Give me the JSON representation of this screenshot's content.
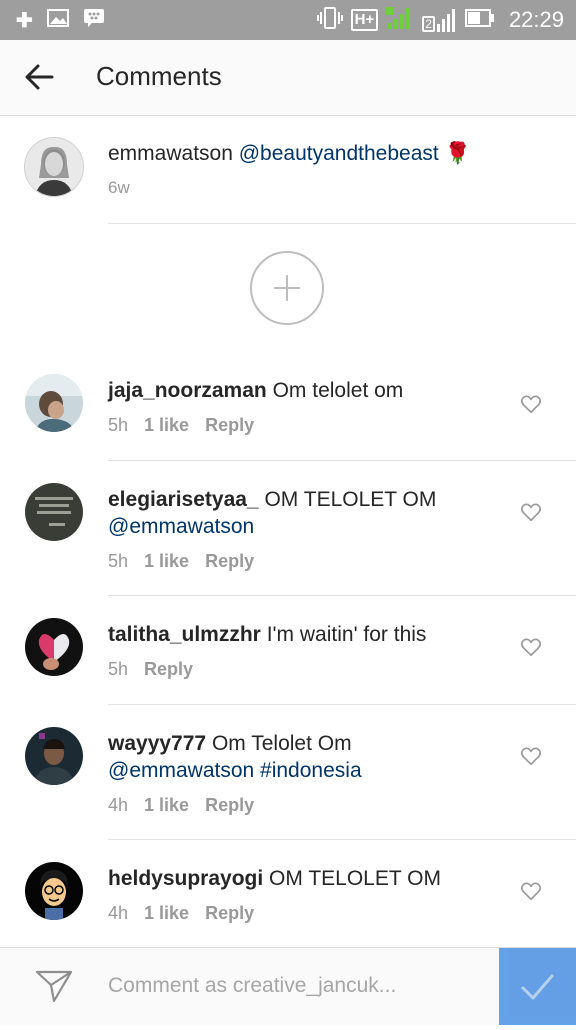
{
  "status_bar": {
    "time": "22:29",
    "network_type": "H+",
    "sim2_label": "2",
    "icons": [
      "kakao-icon",
      "image-icon",
      "bbm-icon",
      "vibrate-icon",
      "network-icon",
      "signal-icon",
      "battery-icon"
    ]
  },
  "header": {
    "title": "Comments",
    "back_icon": "arrow-left-icon"
  },
  "caption": {
    "username": "emmawatson",
    "text": "@beautyandthebeast",
    "emoji": "🌹",
    "time": "6w"
  },
  "load_more_icon": "plus-circle-icon",
  "comments": [
    {
      "username": "jaja_noorzaman",
      "text": "Om telolet om",
      "mention": "",
      "time": "5h",
      "likes": "1 like",
      "reply": "Reply"
    },
    {
      "username": "elegiarisetyaa_",
      "text": "OM TELOLET OM",
      "mention": "@emmawatson",
      "time": "5h",
      "likes": "1 like",
      "reply": "Reply"
    },
    {
      "username": "talitha_ulmzzhr",
      "text": "I'm waitin' for this",
      "mention": "",
      "time": "5h",
      "likes": "",
      "reply": "Reply"
    },
    {
      "username": "wayyy777",
      "text": "Om Telolet Om",
      "mention": "@emmawatson #indonesia",
      "time": "4h",
      "likes": "1 like",
      "reply": "Reply"
    },
    {
      "username": "heldysuprayogi",
      "text": "OM TELOLET OM",
      "mention": "",
      "time": "4h",
      "likes": "1 like",
      "reply": "Reply"
    }
  ],
  "composer": {
    "placeholder": "Comment as creative_jancuk...",
    "value": "",
    "direct_icon": "paper-plane-icon",
    "post_icon": "checkmark-icon"
  },
  "colors": {
    "status_bar": "#9e9e9e",
    "link": "#003569",
    "meta": "#999999",
    "post_button": "#4a90e2"
  }
}
